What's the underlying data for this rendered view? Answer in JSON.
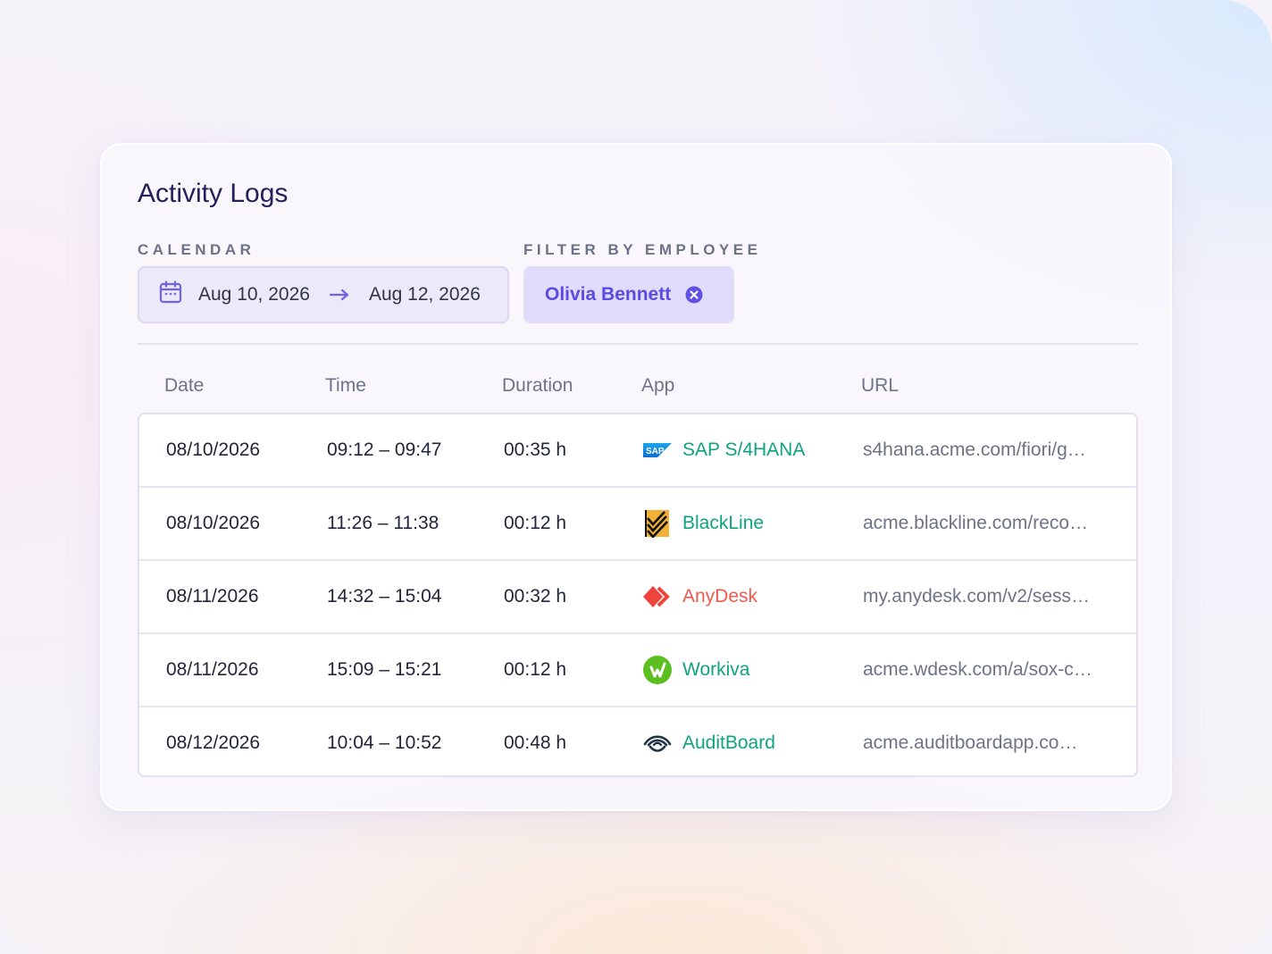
{
  "header": {
    "title": "Activity Logs"
  },
  "filters": {
    "calendar_label": "CALENDAR",
    "date_from": "Aug 10, 2026",
    "date_to": "Aug 12, 2026",
    "employee_label": "FILTER BY EMPLOYEE",
    "employee_name": "Olivia Bennett"
  },
  "table": {
    "columns": [
      "Date",
      "Time",
      "Duration",
      "App",
      "URL"
    ],
    "rows": [
      {
        "date": "08/10/2026",
        "time": "09:12 – 09:47",
        "duration": "00:35 h",
        "app": "SAP S/4HANA",
        "app_icon": "sap-logo-icon",
        "app_color": "#0fa37f",
        "url": "s4hana.acme.com/fiori/g…"
      },
      {
        "date": "08/10/2026",
        "time": "11:26 – 11:38",
        "duration": "00:12 h",
        "app": "BlackLine",
        "app_icon": "blackline-logo-icon",
        "app_color": "#0fa37f",
        "url": "acme.blackline.com/reco…"
      },
      {
        "date": "08/11/2026",
        "time": "14:32 – 15:04",
        "duration": "00:32 h",
        "app": "AnyDesk",
        "app_icon": "anydesk-logo-icon",
        "app_color": "#ef5a4c",
        "url": "my.anydesk.com/v2/sess…"
      },
      {
        "date": "08/11/2026",
        "time": "15:09 – 15:21",
        "duration": "00:12 h",
        "app": "Workiva",
        "app_icon": "workiva-logo-icon",
        "app_color": "#0fa37f",
        "url": "acme.wdesk.com/a/sox-c…"
      },
      {
        "date": "08/12/2026",
        "time": "10:04 – 10:52",
        "duration": "00:48 h",
        "app": "AuditBoard",
        "app_icon": "auditboard-logo-icon",
        "app_color": "#0fa37f",
        "url": "acme.auditboardapp.co…"
      }
    ]
  },
  "colors": {
    "accent": "#5a4ce0",
    "title": "#24215a",
    "app_green": "#0fa37f",
    "app_red": "#ef5a4c"
  }
}
